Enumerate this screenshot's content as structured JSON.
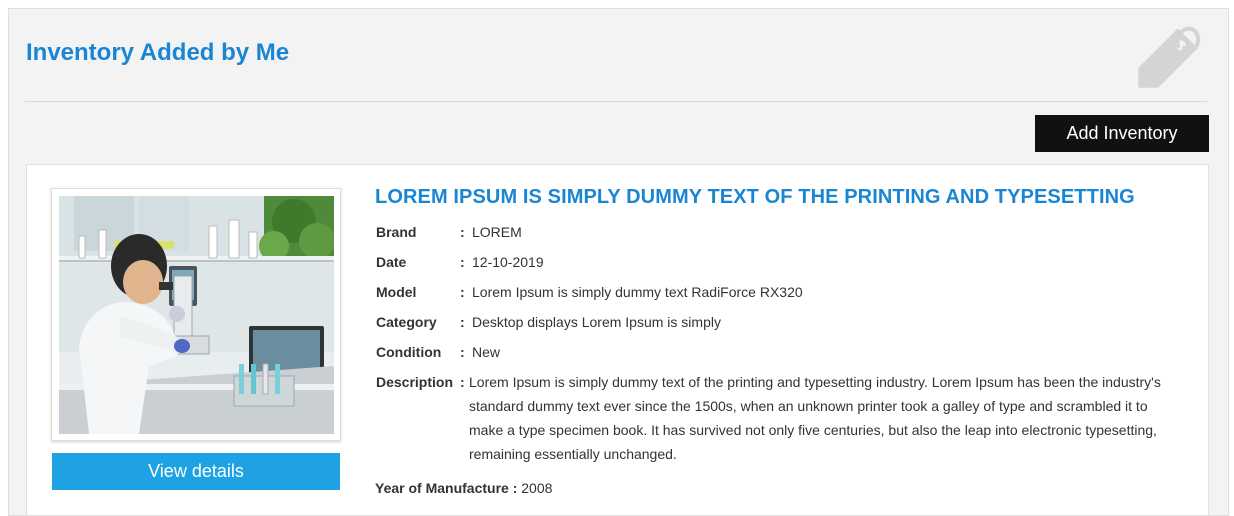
{
  "header": {
    "title": "Inventory Added by Me",
    "icon": "price-tag-icon",
    "add_button": "Add Inventory"
  },
  "item": {
    "title": "LOREM IPSUM IS SIMPLY DUMMY TEXT OF THE PRINTING AND TYPESETTING",
    "image": "lab-scientist-microscope-photo",
    "view_button": "View details",
    "specs": [
      {
        "label": "Brand",
        "value": "LOREM"
      },
      {
        "label": "Date",
        "value": "12-10-2019"
      },
      {
        "label": "Model",
        "value": "Lorem Ipsum is simply dummy text RadiForce RX320"
      },
      {
        "label": "Category",
        "value": "Desktop displays Lorem Ipsum is simply"
      },
      {
        "label": "Condition",
        "value": "New"
      }
    ],
    "description_label": "Description",
    "description": "Lorem Ipsum is simply dummy text of the printing and typesetting industry. Lorem Ipsum has been the industry's standard dummy text ever since the 1500s, when an unknown printer took a galley of type and scrambled it to make a type specimen book. It has survived not only five centuries, but also the leap into electronic typesetting, remaining essentially unchanged.",
    "year_label": "Year of Manufacture :",
    "year_value": "2008"
  },
  "colors": {
    "accent_blue": "#1a86d3",
    "button_blue": "#1ea2e4",
    "button_dark": "#111111"
  }
}
